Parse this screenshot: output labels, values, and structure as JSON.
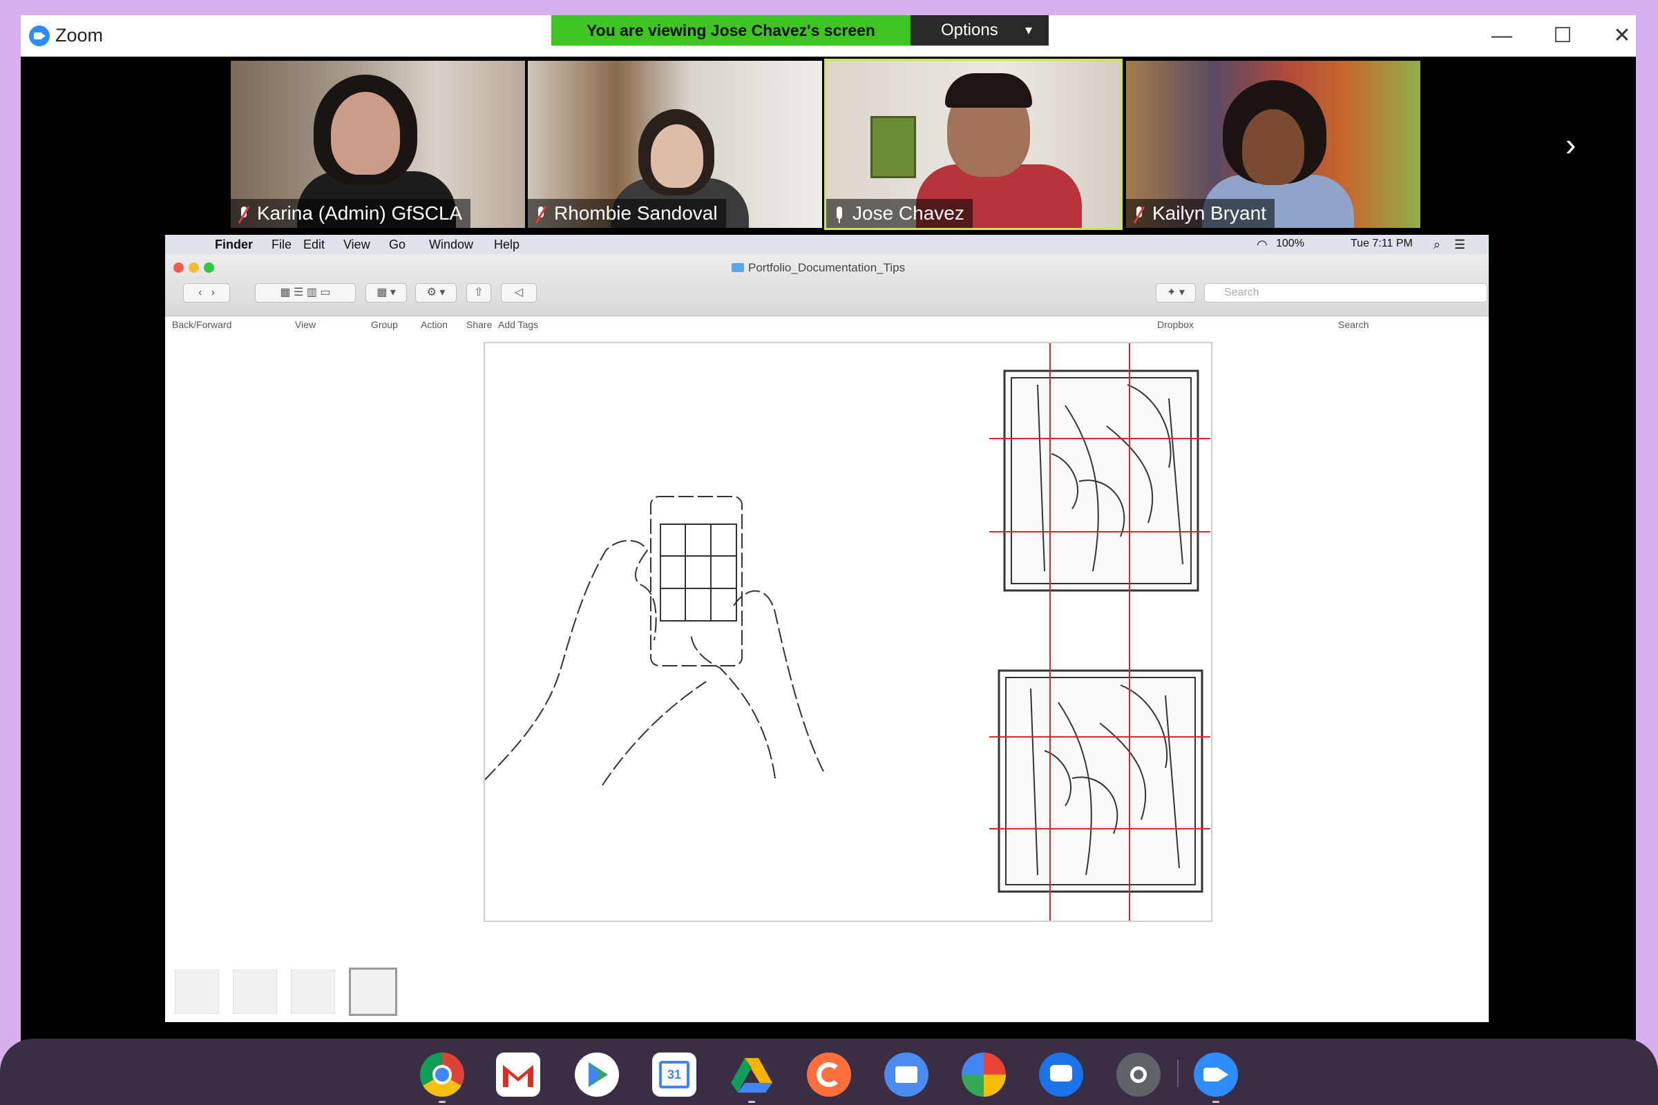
{
  "window": {
    "app_title": "Zoom",
    "share_banner": "You are viewing Jose Chavez's screen",
    "options_label": "Options",
    "minimize_glyph": "—",
    "maximize_glyph": "☐",
    "close_glyph": "✕",
    "next_glyph": "›"
  },
  "participants": [
    {
      "name": "Karina (Admin) GfSCLA",
      "muted": true
    },
    {
      "name": "Rhombie Sandoval",
      "muted": true
    },
    {
      "name": "Jose Chavez",
      "muted": false,
      "active_speaker": true
    },
    {
      "name": "Kailyn Bryant",
      "muted": true
    }
  ],
  "shared_screen": {
    "menubar": {
      "apple_glyph": "",
      "items": [
        "Finder",
        "File",
        "Edit",
        "View",
        "Go",
        "Window",
        "Help"
      ],
      "battery": "100%",
      "clock": "Tue 7:11 PM"
    },
    "finder": {
      "folder_title": "Portfolio_Documentation_Tips",
      "toolbar_labels": {
        "back_forward": "Back/Forward",
        "view": "View",
        "group": "Group",
        "action": "Action",
        "share": "Share",
        "add_tags": "Add Tags",
        "dropbox": "Dropbox",
        "search": "Search"
      },
      "search_placeholder": "Search",
      "thumbnail_count": 4,
      "selected_thumbnail": 4
    }
  },
  "shelf_apps": [
    "Chrome",
    "Gmail",
    "Play Store",
    "Calendar",
    "Drive",
    "Clipchamp",
    "Files",
    "Photos",
    "Messages",
    "Camera",
    "Zoom"
  ],
  "calendar_date": "31",
  "colors": {
    "background": "#d6b0ee",
    "share_banner": "#3fc521",
    "active_speaker_border": "#c9e64a",
    "shelf": "#3a2e47",
    "grid_lines": "#d8282f"
  }
}
